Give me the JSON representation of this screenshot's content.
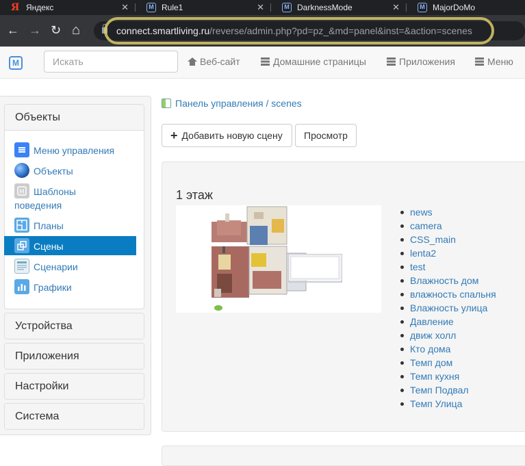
{
  "browser": {
    "tabs": [
      {
        "title": "Яндекс",
        "icon": "yandex-icon",
        "glyph": "Я"
      },
      {
        "title": "Rule1",
        "icon": "majordomo-icon",
        "glyph": "M"
      },
      {
        "title": "DarknessMode",
        "icon": "majordomo-icon",
        "glyph": "M"
      },
      {
        "title": "MajorDoMo",
        "icon": "majordomo-icon",
        "glyph": "M"
      }
    ],
    "close_glyph": "✕",
    "url_host": "connect.smartliving.ru",
    "url_path": "/reverse/admin.php?pd=pz_&md=panel&inst=&action=scenes",
    "nav": {
      "back": "←",
      "forward": "→",
      "reload": "↻",
      "home": "⌂"
    }
  },
  "topnav": {
    "brand_glyph": "M",
    "search_placeholder": "Искать",
    "links": {
      "website": "Веб-сайт",
      "home_pages": "Домашние страницы",
      "apps": "Приложения",
      "menu": "Меню"
    }
  },
  "sidebar": {
    "objects_header": "Объекты",
    "items": [
      {
        "label": "Меню управления",
        "icon": "menu-icon"
      },
      {
        "label": "Объекты",
        "icon": "globe-icon"
      },
      {
        "label_line1": "Шаблоны",
        "label_line2": "поведения",
        "icon": "template-icon"
      },
      {
        "label": "Планы",
        "icon": "plan-icon"
      },
      {
        "label": "Сцены",
        "icon": "scenes-icon",
        "active": true
      },
      {
        "label": "Сценарии",
        "icon": "scripts-icon"
      },
      {
        "label": "Графики",
        "icon": "charts-icon"
      }
    ],
    "sections": [
      "Устройства",
      "Приложения",
      "Настройки",
      "Система"
    ]
  },
  "main": {
    "breadcrumb_root": "Панель управления",
    "breadcrumb_sep": " / ",
    "breadcrumb_current": "scenes",
    "add_button": "Добавить новую сцену",
    "preview_button": "Просмотр",
    "scene": {
      "title": "1 этаж",
      "items": [
        "news",
        "camera",
        "CSS_main",
        "lenta2",
        "test",
        "Влажность дом",
        "влажность спальня",
        "Влажность улица",
        "Давление",
        "движ холл",
        "Кто дома",
        "Темп дом",
        "Темп кухня",
        "Темп Подвал",
        "Темп Улица"
      ]
    }
  },
  "colors": {
    "link": "#337ab7",
    "active": "#0a7dc2",
    "highlight": "#d9c96a"
  }
}
